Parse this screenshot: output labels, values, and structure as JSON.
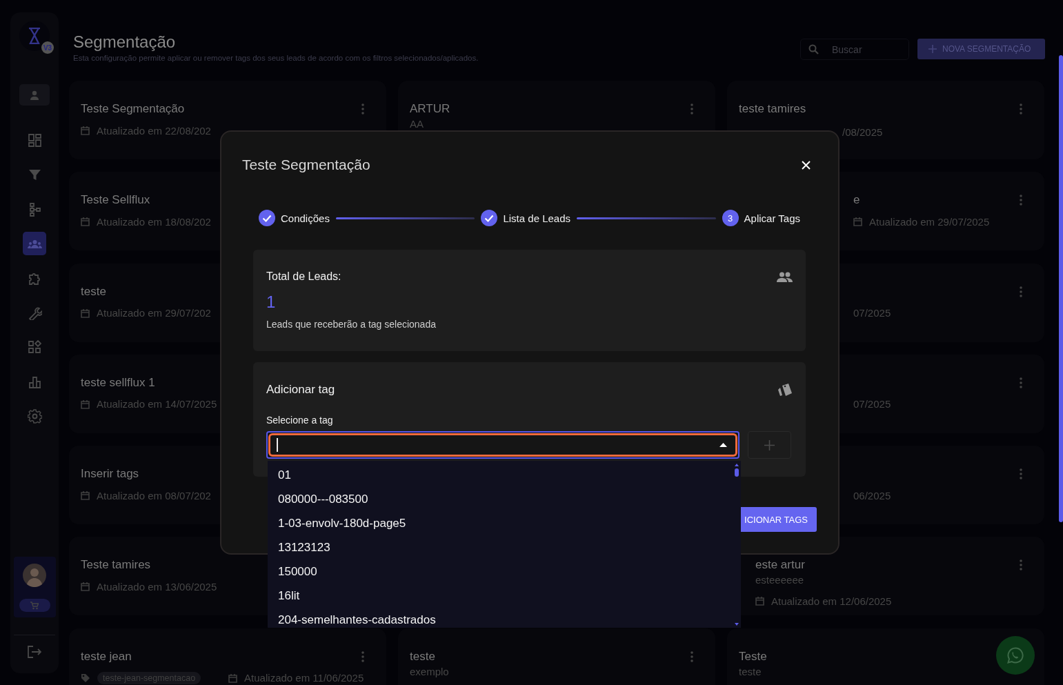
{
  "sidebar": {
    "badge": "V3",
    "nav_items": [
      {
        "selected": false
      },
      {
        "selected": false
      },
      {
        "selected": false
      },
      {
        "selected": true
      },
      {
        "selected": false
      },
      {
        "selected": false
      },
      {
        "selected": false
      },
      {
        "selected": false
      },
      {
        "selected": false
      }
    ]
  },
  "header": {
    "title": "Segmentação",
    "subtitle": "Esta configuração permite aplicar ou remover tags dos seus leads de acordo com os filtros selecionados/aplicados.",
    "search": {
      "placeholder": "Buscar"
    },
    "new_button": "NOVA SEGMENTAÇÃO"
  },
  "columns": [
    [
      {
        "kind": "full",
        "title": "Teste Segmentação",
        "date": "Atualizado em 22/08/202",
        "date_icon": true,
        "menu": true
      },
      {
        "kind": "full",
        "title": "Teste Sellflux",
        "date": "Atualizado em 18/08/202",
        "date_icon": true,
        "menu": false
      },
      {
        "kind": "full",
        "title": "teste",
        "date": "Atualizado em 29/07/202",
        "date_icon": true,
        "menu": false
      },
      {
        "kind": "full",
        "title": "teste sellflux 1",
        "date": "Atualizado em 14/07/2025",
        "date_icon": true,
        "menu": false
      },
      {
        "kind": "full",
        "title": "Inserir tags",
        "date": "Atualizado em 08/07/202",
        "date_icon": true,
        "menu": false
      },
      {
        "kind": "full",
        "title": "Teste tamires",
        "date": "Atualizado em 13/06/2025",
        "date_icon": true,
        "menu": false
      },
      {
        "kind": "full",
        "title": "teste jean",
        "tag": "teste-jean-segmentacao",
        "date": "Atualizado em 11/06/2025",
        "date_icon": true,
        "menu": true
      }
    ],
    [
      {
        "kind": "full",
        "title": "ARTUR",
        "description": "AA",
        "menu": true
      },
      {
        "kind": "full",
        "title": "teste",
        "description": "exemplo",
        "menu": true
      }
    ],
    [
      {
        "kind": "full",
        "title": "teste tamires",
        "menu": true
      },
      {
        "kind": "cut_left",
        "title": "e",
        "date": "Atualizado em 29/07/2025",
        "date_icon": true,
        "menu": true
      },
      {
        "kind": "cut_left",
        "date": "07/2025",
        "date_icon": false,
        "menu": true
      },
      {
        "kind": "cut_left",
        "date": "07/2025",
        "date_icon": false,
        "menu": true
      },
      {
        "kind": "cut_left",
        "date": "06/2025",
        "date_icon": false,
        "menu": true
      },
      {
        "kind": "cut_edge",
        "title": "este artur",
        "description": "esteeeeee",
        "date": "Atualizado em 12/06/2025",
        "date_icon": true,
        "menu": true
      },
      {
        "kind": "full",
        "title": "Teste",
        "description": "teste",
        "menu": false
      }
    ]
  ],
  "right_fragment": "/08/2025",
  "modal": {
    "title": "Teste Segmentação",
    "steps": [
      {
        "label": "Condições",
        "completed": true
      },
      {
        "label": "Lista de Leads",
        "completed": true
      },
      {
        "label": "Aplicar Tags",
        "number": "3",
        "completed": false
      }
    ],
    "leads_box": {
      "title": "Total de Leads:",
      "count": "1",
      "caption": "Leads que receberão a tag selecionada"
    },
    "tag_box": {
      "title": "Adicionar tag",
      "field_label": "Selecione a tag",
      "focused": true,
      "open": true,
      "add_disabled": true
    },
    "options": [
      {
        "label": "01",
        "selected": false
      },
      {
        "label": "080000---083500",
        "selected": false
      },
      {
        "label": "1-03-envolv-180d-page5",
        "selected": false
      },
      {
        "label": "13123123",
        "selected": false
      },
      {
        "label": "150000",
        "selected": false
      },
      {
        "label": "16lit",
        "selected": false
      },
      {
        "label": "204-semelhantes-cadastrados",
        "selected": false
      }
    ],
    "submit_button": "ICIONAR TAGS"
  }
}
